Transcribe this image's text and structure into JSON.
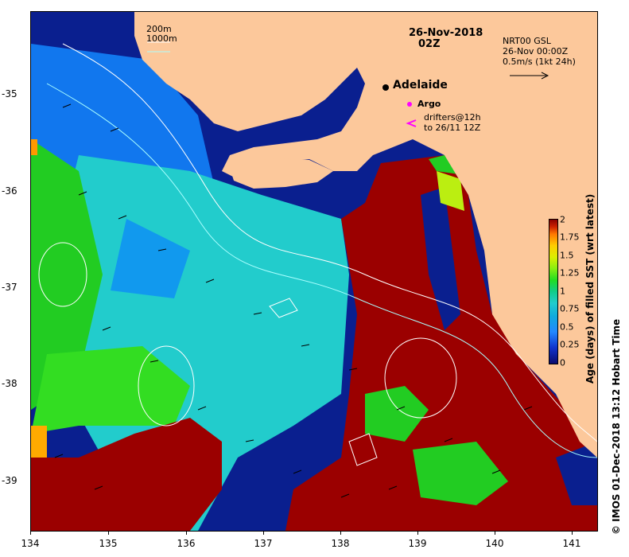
{
  "map": {
    "date_line1": "26-Nov-2018",
    "date_line2": "02Z",
    "contour_legend": [
      "200m",
      "1000m"
    ],
    "product": "NRT00 GSL",
    "product_time": "26-Nov 00:00Z",
    "vector_scale": "0.5m/s (1kt 24h)",
    "city": "Adelaide",
    "argo_label": "Argo",
    "drifters_line1": "drifters@12h",
    "drifters_line2": "to 26/11 12Z",
    "colorbar_title": "Age (days) of filled SST (wrt latest)",
    "colorbar_ticks": [
      "2",
      "1.75",
      "1.5",
      "1.25",
      "1",
      "0.75",
      "0.5",
      "0.25",
      "0"
    ],
    "x_ticks": [
      "134",
      "135",
      "136",
      "137",
      "138",
      "139",
      "140",
      "141"
    ],
    "y_ticks": [
      "-35",
      "-36",
      "-37",
      "-38",
      "-39"
    ],
    "credit": "© IMOS 01-Dec-2018 13:12 Hobart Time",
    "colors": {
      "land": "#fcc89b",
      "dark_blue": "#0a1f8f",
      "dark_red": "#9b0000",
      "cyan": "#22cccc",
      "green": "#22cc22",
      "argo": "#ff00ff"
    }
  }
}
